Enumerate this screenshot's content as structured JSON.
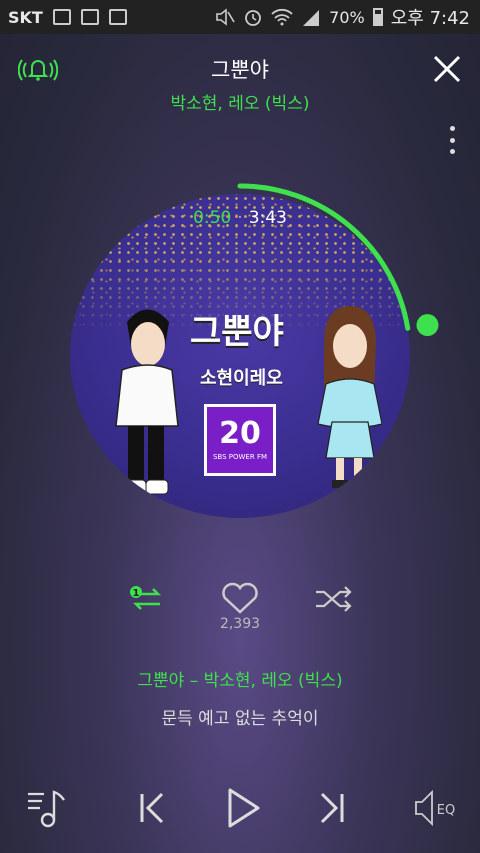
{
  "status": {
    "carrier": "SKT",
    "battery": "70%",
    "time": "오후 7:42"
  },
  "song": {
    "title": "그뿐야",
    "artist": "박소현, 레오 (빅스)"
  },
  "artwork": {
    "title": "그뿐야",
    "subtitle": "소현이레오",
    "badge_number": "20",
    "badge_text": "SBS POWER FM"
  },
  "playback": {
    "current": "0:50",
    "total": "3:43",
    "progress": 0.224
  },
  "like_count": "2,393",
  "lyrics": {
    "heading": "그뿐야 – 박소현, 레오 (빅스)",
    "line": "문득 예고 없는 추억이"
  },
  "colors": {
    "accent": "#3fe04d",
    "background": "#2a2a3e"
  },
  "icons": [
    "alarm-bell-icon",
    "close-icon",
    "more-vertical-icon",
    "repeat-one-icon",
    "heart-icon",
    "shuffle-icon",
    "playlist-icon",
    "previous-icon",
    "play-icon",
    "next-icon",
    "equalizer-icon"
  ]
}
